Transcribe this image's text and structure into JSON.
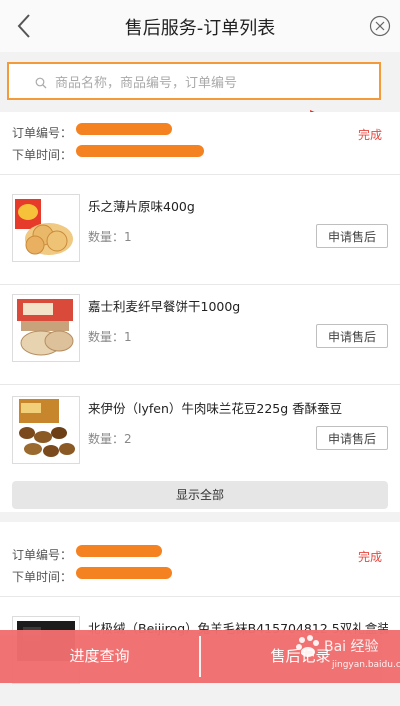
{
  "header": {
    "title": "售后服务-订单列表"
  },
  "search": {
    "placeholder": "商品名称，商品编号，订单编号"
  },
  "order_labels": {
    "order_no": "订单编号：",
    "order_time": "下单时间："
  },
  "orders": [
    {
      "status": "完成",
      "items": [
        {
          "name": "乐之薄片原味400g",
          "qty_label": "数量：1",
          "apply_label": "申请售后"
        },
        {
          "name": "嘉士利麦纤早餐饼干1000g",
          "qty_label": "数量：1",
          "apply_label": "申请售后"
        },
        {
          "name": "来伊份（lyfen）牛肉味兰花豆225g 香酥蚕豆",
          "qty_label": "数量：2",
          "apply_label": "申请售后"
        }
      ],
      "show_all_label": "显示全部"
    },
    {
      "status": "完成",
      "items": [
        {
          "name": "北极绒（Beijirog）兔羊毛袜B415704812 5双礼盒装"
        }
      ]
    }
  ],
  "bottom_bar": {
    "progress_label": "进度查询",
    "aftersale_label": "售后记录"
  },
  "watermark": {
    "text": "Bai 经验",
    "url": "jingyan.baidu.com"
  },
  "colors": {
    "accent": "#f16e6e",
    "status": "#e8473f",
    "highlight": "#f39a3b",
    "redacted": "#f58220"
  }
}
